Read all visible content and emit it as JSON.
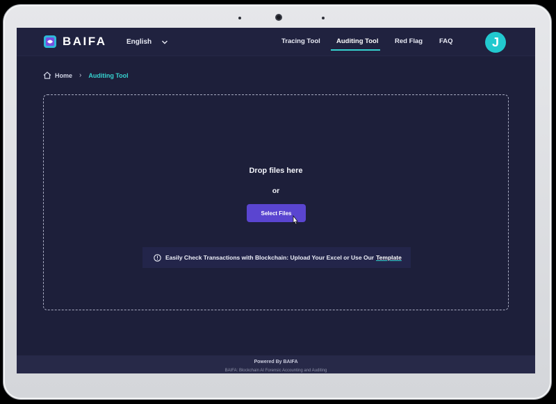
{
  "navbar": {
    "brand": "BAIFA",
    "language": "English",
    "links": [
      "Tracing Tool",
      "Auditing Tool",
      "Red Flag",
      "FAQ"
    ],
    "active_link": "Auditing Tool",
    "avatar_initial": "J"
  },
  "breadcrumb": {
    "home": "Home",
    "current": "Auditing Tool"
  },
  "upload": {
    "title": "Drop files here",
    "or": "or",
    "button": "Select Files",
    "hint": "Easily Check Transactions with Blockchain: Upload Your Excel or Use Our",
    "hint_link": "Template"
  },
  "footer": {
    "powered": "Powered By BAIFA",
    "sub": "BAIFA: Blockchain AI Forensic Accounting and Auditing"
  },
  "colors": {
    "background": "#1d1f3a",
    "accent": "#36d3d0",
    "button": "#5a45d0"
  }
}
